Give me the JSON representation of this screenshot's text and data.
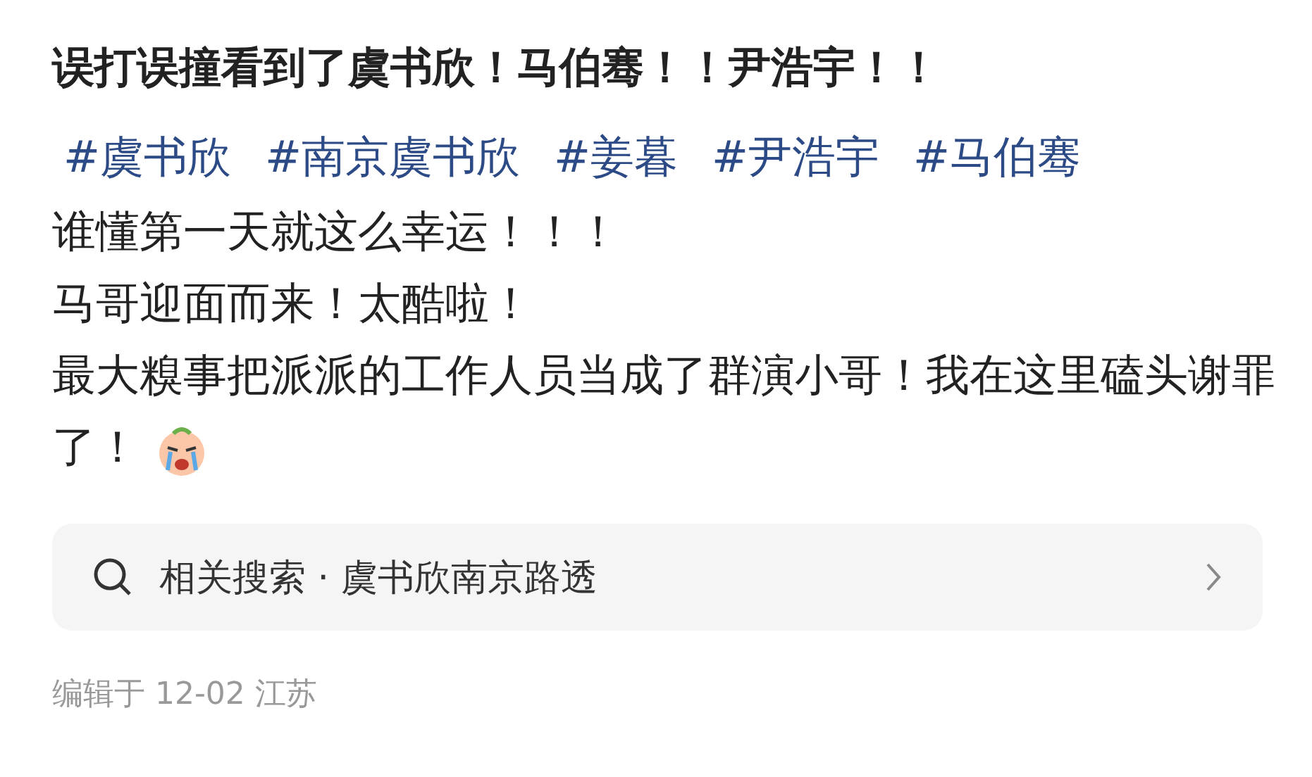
{
  "title": "误打误撞看到了虞书欣！马伯骞！！尹浩宇！！",
  "tags": [
    "#虞书欣",
    "#南京虞书欣",
    "#姜暮",
    "#尹浩宇",
    "#马伯骞"
  ],
  "body": [
    "谁懂第一天就这么幸运！！！",
    "马哥迎面而来！太酷啦！",
    "最大糗事把派派的工作人员当成了群演小哥！我在这里磕头谢罪了！"
  ],
  "related_search": {
    "label": "相关搜索 · 虞书欣南京路透"
  },
  "footer": "编辑于 12-02 江苏"
}
